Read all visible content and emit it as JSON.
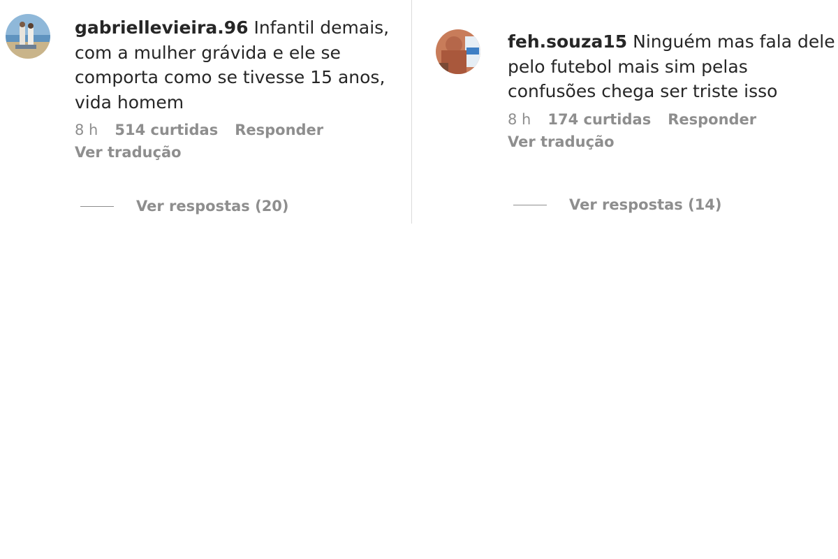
{
  "comments": [
    {
      "username": "gabriellevieira.96",
      "text": "Infantil demais,\ncom a mulher grávida e ele se\ncomporta como se tivesse 15 anos,\nvida homem",
      "time": "8 h",
      "likes": "514 curtidas",
      "reply_label": "Responder",
      "translate_label": "Ver tradução",
      "view_replies": "Ver respostas (20)",
      "avatar_icon": "profile-photo-beach"
    },
    {
      "username": "feh.souza15",
      "text": "Ninguém mas fala dele\npelo futebol mais sim pelas\nconfusões chega ser triste isso",
      "time": "8 h",
      "likes": "174 curtidas",
      "reply_label": "Responder",
      "translate_label": "Ver tradução",
      "view_replies": "Ver respostas (14)",
      "avatar_icon": "profile-photo-person"
    }
  ],
  "colors": {
    "primary_text": "#262626",
    "secondary_text": "#8e8e8e",
    "divider": "#dbdbdb"
  }
}
